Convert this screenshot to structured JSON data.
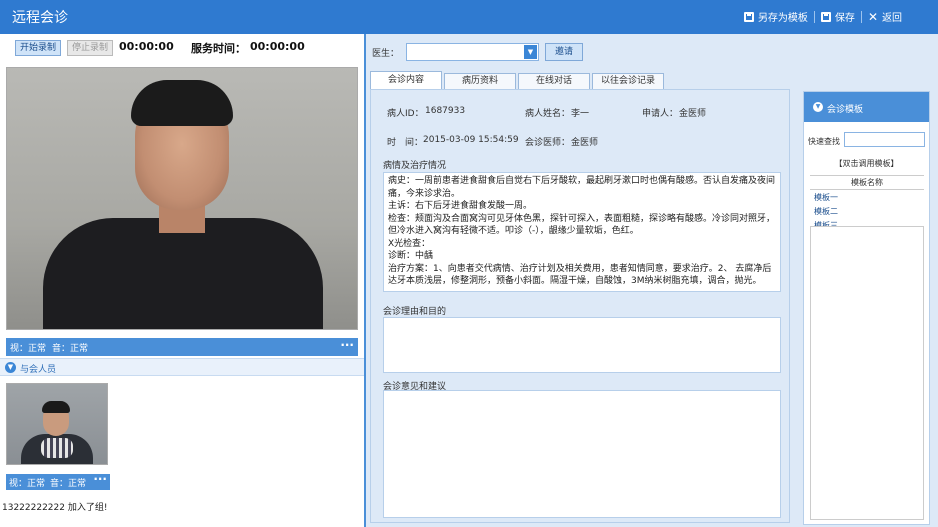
{
  "window": {
    "title": "远程会诊",
    "save_template_label": "另存为模板",
    "save_label": "保存",
    "back_label": "返回"
  },
  "recording": {
    "start_label": "开始录制",
    "stop_label": "停止录制",
    "record_time": "00:00:00",
    "service_time_label": "服务时间：",
    "service_time": "00:00:00"
  },
  "main_video": {
    "video_status": "视：正常",
    "audio_status": "音：正常",
    "more": "···"
  },
  "attendees": {
    "header": "与会人员",
    "video_status": "视：正常",
    "audio_status": "音：正常",
    "more": "···",
    "message": "13222222222 加入了组!"
  },
  "doctor_select": {
    "label": "医生：",
    "value": "",
    "invite_label": "邀请"
  },
  "tabs": [
    {
      "label": "会诊内容",
      "active": true
    },
    {
      "label": "病历资料",
      "active": false
    },
    {
      "label": "在线对话",
      "active": false
    },
    {
      "label": "以往会诊记录",
      "active": false
    }
  ],
  "patient": {
    "id_label": "病人ID：",
    "id": "1687933",
    "name_label": "病人姓名：",
    "name": "李一",
    "applicant_label": "申请人：",
    "applicant": "金医师",
    "time_label": "时　间：",
    "time": "2015-03-09 15:54:59",
    "doctor_label": "会诊医师：",
    "doctor": "金医师"
  },
  "sections": {
    "history_title": "病情及治疗情况",
    "history_lines": [
      "病史：一周前患者进食甜食后自觉右下后牙酸软，最起刷牙漱口时也偶有酸感。否认自发痛及夜间痛，今来诊求治。",
      "主诉：右下后牙进食甜食发酸一周。",
      "检查：颊面沟及合面窝沟可见牙体色黑，探针可探入，表面粗糙，探诊略有酸感。冷诊同对照牙，但冷水进入窝沟有轻微不适。叩诊（-），龈缘少量软垢，色红。",
      "X光检查：",
      "诊断：中龋",
      "治疗方案：1、向患者交代病情、治疗计划及相关费用，患者知情同意，要求治疗。2、 去腐净后达牙本质浅层，修整洞形，预备小斜面。隔湿干燥，自酸蚀，3M纳米树脂充填，调合，抛光。"
    ],
    "reason_title": "会诊理由和目的",
    "reason_text": "",
    "opinion_title": "会诊意见和建议",
    "opinion_text": ""
  },
  "templates": {
    "header": "会诊模板",
    "quick_label": "快速查找",
    "quick_value": "",
    "hint": "【双击调用模板】",
    "column": "模板名称",
    "items": [
      "模板一",
      "模板二",
      "模板三"
    ]
  },
  "colors": {
    "title_bar": "#2f7ad0",
    "accent": "#4a8fd8",
    "panel_bg": "#dde9f7"
  },
  "icons": {
    "save_template": "save-icon",
    "save": "save-icon",
    "back": "close-icon",
    "dropdown": "chevron-down-icon",
    "collapse": "chevron-down-circle-icon"
  }
}
